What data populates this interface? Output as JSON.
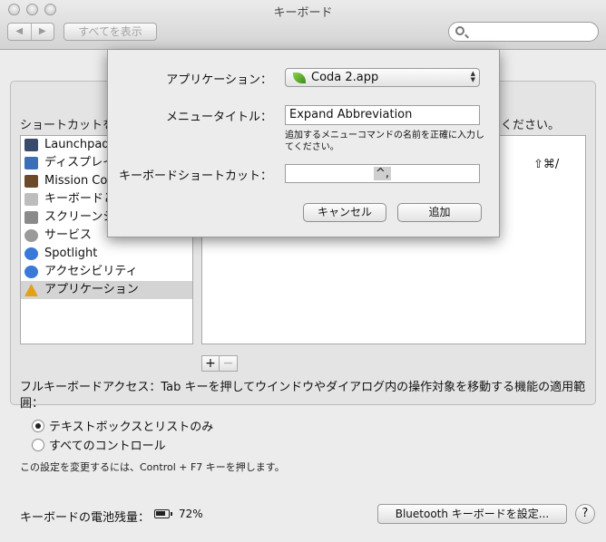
{
  "window": {
    "title": "キーボード",
    "back_icon": "◀",
    "forward_icon": "▶",
    "show_all": "すべてを表示",
    "search_placeholder": ""
  },
  "pane": {
    "instruction": "ショートカットを",
    "instruction_end": "ください。",
    "categories": [
      {
        "label": "Launchpad と Dock",
        "icon": "launchpad-icon",
        "color": "#3a4a6b"
      },
      {
        "label": "ディスプレイ",
        "icon": "display-icon",
        "color": "#3b6fb8"
      },
      {
        "label": "Mission Control",
        "icon": "mission-control-icon",
        "color": "#6b4a2c"
      },
      {
        "label": "キーボードと文字入力",
        "icon": "keyboard-icon",
        "color": "#bdbdbd"
      },
      {
        "label": "スクリーンショット",
        "icon": "screenshot-icon",
        "color": "#8a8a8a"
      },
      {
        "label": "サービス",
        "icon": "gear-icon",
        "color": "#9a9a9a"
      },
      {
        "label": "Spotlight",
        "icon": "spotlight-icon",
        "color": "#3b79d8"
      },
      {
        "label": "アクセシビリティ",
        "icon": "accessibility-icon",
        "color": "#3b79d8"
      },
      {
        "label": "アプリケーション",
        "icon": "applications-icon",
        "color": "#e3a018"
      }
    ],
    "shortcut_display": "⇧⌘/",
    "plus": "+",
    "minus": "−",
    "full_keyboard_access": "フルキーボードアクセス：Tab キーを押してウインドウやダイアログ内の操作対象を移動する機能の適用範囲：",
    "radio_text_boxes": "テキストボックスとリストのみ",
    "radio_all_controls": "すべてのコントロール",
    "note": "この設定を変更するには、Control + F7 キーを押します。",
    "battery_label": "キーボードの電池残量：",
    "battery_percent": "72%",
    "bluetooth_button": "Bluetooth キーボードを設定...",
    "help": "?"
  },
  "dialog": {
    "application_label": "アプリケーション：",
    "application_value": "Coda 2.app",
    "menu_title_label": "メニュータイトル：",
    "menu_title_value": "Expand Abbreviation",
    "hint": "追加するメニューコマンドの名前を正確に入力してください。",
    "shortcut_label": "キーボードショートカット：",
    "shortcut_value": "^,",
    "cancel": "キャンセル",
    "add": "追加"
  }
}
